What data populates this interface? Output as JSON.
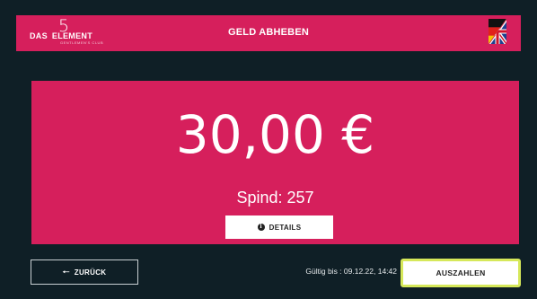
{
  "header": {
    "logo": {
      "numeral": "5",
      "left": "DAS",
      "right": "ELEMENT",
      "tagline": "GENTLEMEN'S CLUB"
    },
    "title": "GELD ABHEBEN",
    "language_icon": "german-uk-flag-icon"
  },
  "main": {
    "amount": "30,00 €",
    "locker": "Spind: 257",
    "details_label": "DETAILS",
    "details_icon": "info-icon"
  },
  "footer": {
    "back_label": "ZURÜCK",
    "back_icon": "arrow-left-icon",
    "valid_text": "Gültig bis : 09.12.22, 14:42",
    "payout_label": "AUSZAHLEN"
  },
  "colors": {
    "background": "#0f1f26",
    "accent": "#d61f5c",
    "focus": "#d6e85a"
  }
}
